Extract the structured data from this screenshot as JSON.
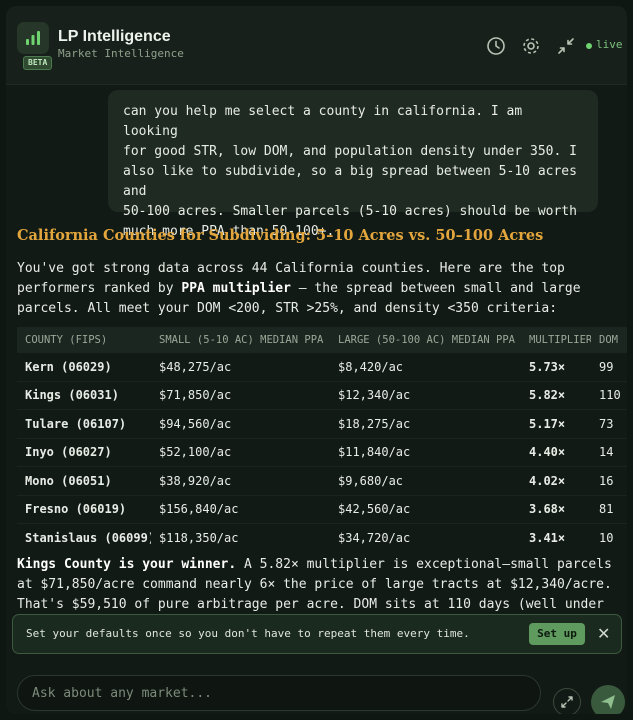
{
  "header": {
    "title": "LP Intelligence",
    "subtitle": "Market Intelligence",
    "badge": "BETA",
    "status": "live",
    "icons": [
      "history-icon",
      "settings-icon",
      "collapse-icon"
    ]
  },
  "user_message": "can you help me select a county in california. I am looking\nfor good STR, low DOM, and population density under 350. I\nalso like to subdivide, so a big spread between 5-10 acres and\n50-100 acres. Smaller parcels (5-10 acres) should be worth\nmuch more PPA than 50-100+.",
  "answer": {
    "title": "California Counties for Subdividing: 5–10 Acres vs. 50–100 Acres",
    "intro_1": "You've got strong data across 44 California counties. Here are the top performers ranked by ",
    "intro_bold": "PPA multiplier",
    "intro_2": " — the spread between small and large parcels. All meet your DOM <200, STR >25%, and density <350 criteria:",
    "table": {
      "headers": [
        "COUNTY (FIPS)",
        "SMALL (5-10 AC) MEDIAN PPA",
        "LARGE (50-100 AC) MEDIAN PPA",
        "MULTIPLIER",
        "DOM"
      ],
      "rows": [
        [
          "Kern (06029)",
          "$48,275/ac",
          "$8,420/ac",
          "5.73×",
          "99"
        ],
        [
          "Kings (06031)",
          "$71,850/ac",
          "$12,340/ac",
          "5.82×",
          "110"
        ],
        [
          "Tulare (06107)",
          "$94,560/ac",
          "$18,275/ac",
          "5.17×",
          "73"
        ],
        [
          "Inyo (06027)",
          "$52,100/ac",
          "$11,840/ac",
          "4.40×",
          "14"
        ],
        [
          "Mono (06051)",
          "$38,920/ac",
          "$9,680/ac",
          "4.02×",
          "16"
        ],
        [
          "Fresno (06019)",
          "$156,840/ac",
          "$42,560/ac",
          "3.68×",
          "81"
        ],
        [
          "Stanislaus (06099)",
          "$118,350/ac",
          "$34,720/ac",
          "3.41×",
          "10"
        ]
      ]
    },
    "winner_bold": "Kings County is your winner.",
    "winner_text": " A 5.82× multiplier is exceptional—small parcels at $71,850/acre command nearly 6× the price of large tracts at $12,340/acre. That's $59,510 of pure arbitrage per acre. DOM sits at 110 days (well under"
  },
  "toast": {
    "text": "Set your defaults once so you don't have to repeat them every time.",
    "button": "Set up",
    "close": "✕"
  },
  "composer": {
    "placeholder": "Ask about any market..."
  },
  "colors": {
    "accent": "#e3a63d",
    "live": "#6fd36f",
    "button": "#5f9a5f"
  }
}
